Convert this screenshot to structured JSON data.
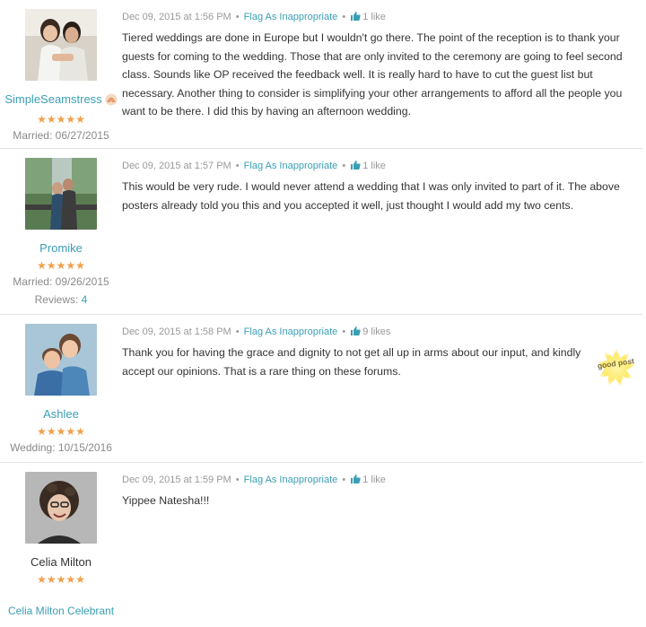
{
  "thread": {
    "posts": [
      {
        "date": "Dec 09, 2015 at 1:56 PM",
        "flag_label": "Flag As Inappropriate",
        "likes": "1 like",
        "username": "SimpleSeamstress",
        "rating": "★★★★★",
        "meta1": "Married: 06/27/2015",
        "body": "Tiered weddings are done in Europe but I wouldn't go there. The point of the reception is to thank your guests for coming to the wedding. Those that are only invited to the ceremony are going to feel second class. Sounds like OP received the feedback well. It is really hard to have to cut the guest list but necessary. Another thing to consider is simplifying your other arrangements to afford all the people you want to be there. I did this by having an afternoon wedding."
      },
      {
        "date": "Dec 09, 2015 at 1:57 PM",
        "flag_label": "Flag As Inappropriate",
        "likes": "1 like",
        "username": "Promike",
        "rating": "★★★★★",
        "meta1": "Married: 09/26/2015",
        "meta2_label": "Reviews: ",
        "meta2_value": "4",
        "body": "This would be very rude. I would never attend a wedding that I was only invited to part of it. The above posters already told you this and you accepted it well, just thought I would add my two cents."
      },
      {
        "date": "Dec 09, 2015 at 1:58 PM",
        "flag_label": "Flag As Inappropriate",
        "likes": "9 likes",
        "username": "Ashlee",
        "rating": "★★★★★",
        "meta1": "Wedding: 10/15/2016",
        "badge_text": "good post",
        "body": "Thank you for having the grace and dignity to not get all up in arms about our input, and kindly accept our opinions. That is a rare thing on these forums."
      },
      {
        "date": "Dec 09, 2015 at 1:59 PM",
        "flag_label": "Flag As Inappropriate",
        "likes": "1 like",
        "username": "Celia Milton",
        "rating": "★★★★★",
        "body": "Yippee Natesha!!!",
        "vendor_link": "Celia Milton Celebrant"
      }
    ]
  },
  "colors": {
    "link": "#3a9fb4",
    "stars": "#f0a04b",
    "divider": "#e2e2e2",
    "meta": "#999999"
  },
  "icons": [
    "thumbs-up-icon",
    "shamrock-badge-icon",
    "good-post-badge"
  ]
}
